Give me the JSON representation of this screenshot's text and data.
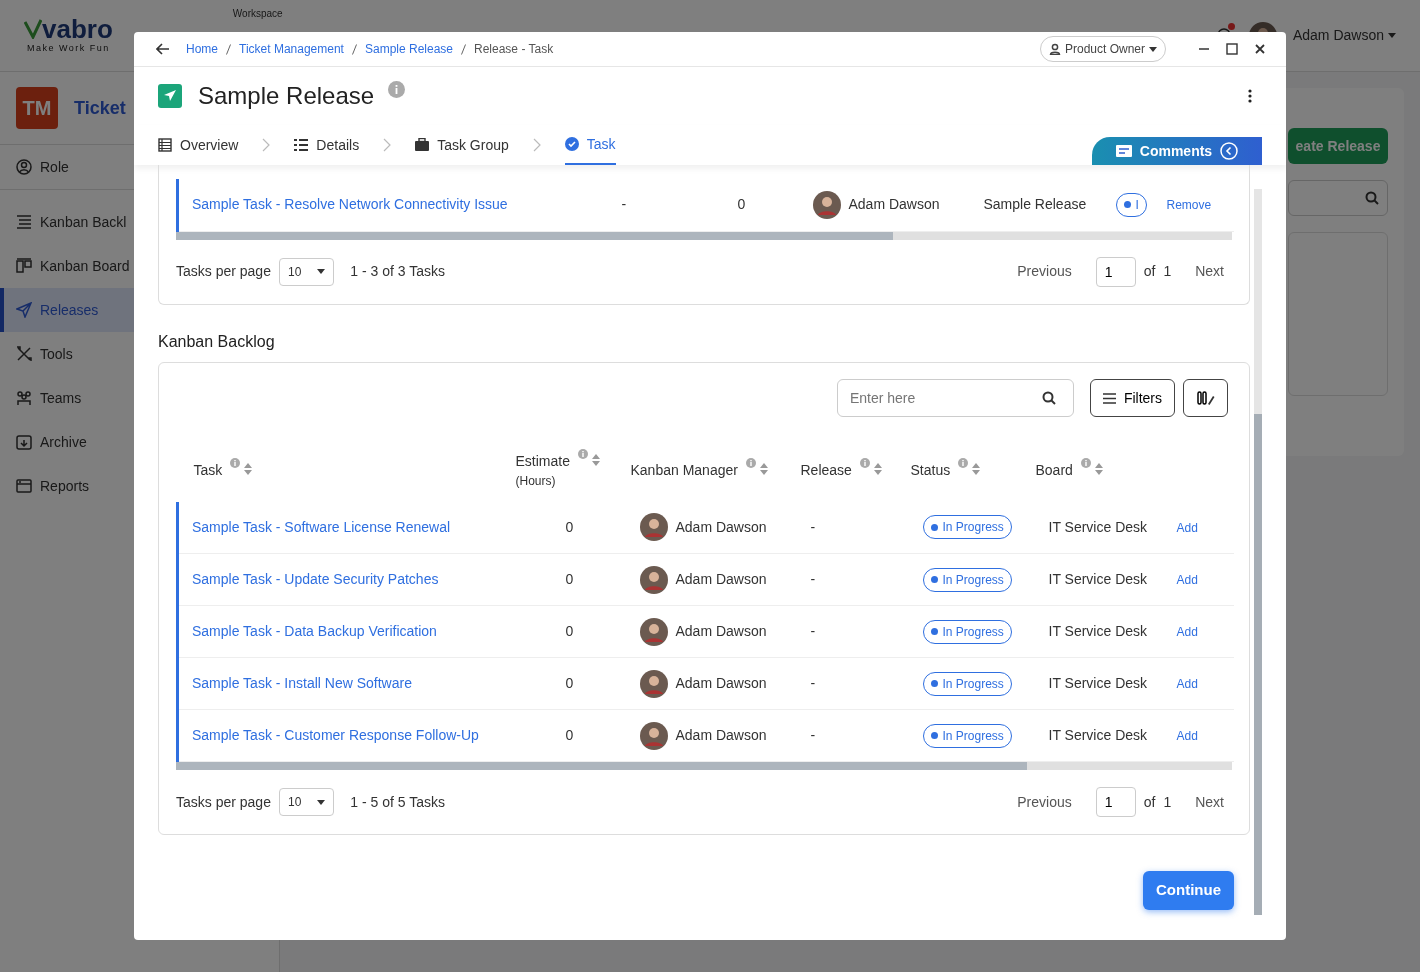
{
  "app_header": {
    "logo_text": "vabro",
    "tagline": "Make Work Fun",
    "workspace_label": "Workspace",
    "user_name": "Adam Dawson",
    "has_notification": true
  },
  "app_sidebar": {
    "badge": "TM",
    "title": "Ticket",
    "items": [
      {
        "label": "Role",
        "selected": false
      },
      {
        "label": "Kanban Backl",
        "selected": false
      },
      {
        "label": "Kanban Board",
        "selected": false
      },
      {
        "label": "Releases",
        "selected": true
      },
      {
        "label": "Tools",
        "selected": false
      },
      {
        "label": "Teams",
        "selected": false
      },
      {
        "label": "Archive",
        "selected": false
      },
      {
        "label": "Reports",
        "selected": false
      }
    ]
  },
  "app_main": {
    "create_button": "eate Release"
  },
  "modal": {
    "breadcrumbs": [
      {
        "label": "Home",
        "link": true
      },
      {
        "label": "Ticket Management",
        "link": true
      },
      {
        "label": "Sample Release",
        "link": true
      },
      {
        "label": "Release - Task",
        "link": false
      }
    ],
    "role_button": "Product Owner",
    "title": "Sample Release",
    "tabs": [
      {
        "label": "Overview",
        "selected": false
      },
      {
        "label": "Details",
        "selected": false
      },
      {
        "label": "Task Group",
        "selected": false
      },
      {
        "label": "Task",
        "selected": true
      }
    ],
    "comments_button": "Comments",
    "release_tasks": {
      "rows": [
        {
          "task": "Sample Task - Resolve Network Connectivity Issue",
          "column_2": "-",
          "column_3": "0",
          "manager": "Adam Dawson",
          "release": "Sample Release",
          "status": "I",
          "action": "Remove"
        }
      ],
      "pagination": {
        "per_page_label": "Tasks per page",
        "per_page": "10",
        "range": "1 - 3 of 3 Tasks",
        "previous": "Previous",
        "page": "1",
        "of": "of",
        "total": "1",
        "next": "Next"
      }
    },
    "backlog": {
      "heading": "Kanban Backlog",
      "search": {
        "placeholder": "Enter here"
      },
      "filters_button": "Filters",
      "columns": [
        {
          "label": "Task"
        },
        {
          "label": "Estimate",
          "sublabel": "(Hours)"
        },
        {
          "label": "Kanban Manager"
        },
        {
          "label": "Release"
        },
        {
          "label": "Status"
        },
        {
          "label": "Board"
        }
      ],
      "rows": [
        {
          "task": "Sample Task - Software License Renewal",
          "estimate": "0",
          "manager": "Adam Dawson",
          "release": "-",
          "status": "In Progress",
          "board": "IT Service Desk",
          "action": "Add"
        },
        {
          "task": "Sample Task - Update Security Patches",
          "estimate": "0",
          "manager": "Adam Dawson",
          "release": "-",
          "status": "In Progress",
          "board": "IT Service Desk",
          "action": "Add"
        },
        {
          "task": "Sample Task - Data Backup Verification",
          "estimate": "0",
          "manager": "Adam Dawson",
          "release": "-",
          "status": "In Progress",
          "board": "IT Service Desk",
          "action": "Add"
        },
        {
          "task": "Sample Task - Install New Software",
          "estimate": "0",
          "manager": "Adam Dawson",
          "release": "-",
          "status": "In Progress",
          "board": "IT Service Desk",
          "action": "Add"
        },
        {
          "task": "Sample Task - Customer Response Follow-Up",
          "estimate": "0",
          "manager": "Adam Dawson",
          "release": "-",
          "status": "In Progress",
          "board": "IT Service Desk",
          "action": "Add"
        }
      ],
      "pagination": {
        "per_page_label": "Tasks per page",
        "per_page": "10",
        "range": "1 - 5 of 5 Tasks",
        "previous": "Previous",
        "page": "1",
        "of": "of",
        "total": "1",
        "next": "Next"
      }
    },
    "continue_button": "Continue"
  }
}
